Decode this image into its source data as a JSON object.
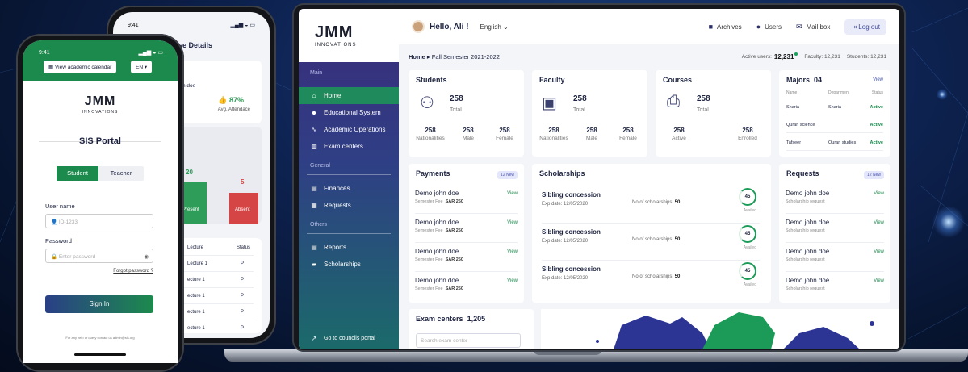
{
  "colors": {
    "accent": "#1f8a5b",
    "brand": "#2f3f85",
    "status_active": "#1c8a4d"
  },
  "laptop": {
    "logo": {
      "main": "JMM",
      "sub": "INNOVATIONS"
    },
    "sidebar": {
      "sections": [
        {
          "title": "Main",
          "items": [
            {
              "label": "Home",
              "icon": "home-icon",
              "active": true
            },
            {
              "label": "Educational System",
              "icon": "graduation-cap-icon"
            },
            {
              "label": "Academic Operations",
              "icon": "wave-icon"
            },
            {
              "label": "Exam centers",
              "icon": "building-icon"
            }
          ]
        },
        {
          "title": "General",
          "items": [
            {
              "label": "Finances",
              "icon": "document-icon"
            },
            {
              "label": "Requests",
              "icon": "file-icon"
            }
          ]
        },
        {
          "title": "Others",
          "items": [
            {
              "label": "Reports",
              "icon": "document-icon"
            },
            {
              "label": "Scholarships",
              "icon": "briefcase-icon"
            }
          ]
        }
      ],
      "footer": "Go to councils portal"
    },
    "header": {
      "greeting": "Hello, Ali !",
      "language": "English",
      "archives": "Archives",
      "users": "Users",
      "mailbox": "Mail box",
      "logout": "Log out"
    },
    "breadcrumb": {
      "home": "Home",
      "semester": "Fall Semester 2021-2022"
    },
    "active_users": {
      "label": "Active users:",
      "value": "12,231",
      "faculty": "Faculty: 12,231",
      "students": "Students: 12,231"
    },
    "students": {
      "title": "Students",
      "total": "258",
      "total_label": "Total",
      "stats": [
        {
          "v": "258",
          "l": "Nationalities"
        },
        {
          "v": "258",
          "l": "Male"
        },
        {
          "v": "258",
          "l": "Female"
        }
      ]
    },
    "faculty": {
      "title": "Faculty",
      "total": "258",
      "total_label": "Total",
      "stats": [
        {
          "v": "258",
          "l": "Nationalities"
        },
        {
          "v": "258",
          "l": "Male"
        },
        {
          "v": "258",
          "l": "Female"
        }
      ]
    },
    "courses": {
      "title": "Courses",
      "total": "258",
      "total_label": "Total",
      "stats": [
        {
          "v": "258",
          "l": "Active"
        },
        {
          "v": "258",
          "l": "Enrolled"
        }
      ]
    },
    "majors": {
      "title": "Majors",
      "count": "04",
      "view": "View",
      "headers": [
        "Name",
        "Department",
        "Status"
      ],
      "rows": [
        {
          "name": "Sharia",
          "dept": "Sharia",
          "status": "Active"
        },
        {
          "name": "Quran science",
          "dept": "",
          "status": "Active"
        },
        {
          "name": "Tafseer",
          "dept": "Quran studies",
          "status": "Active"
        }
      ]
    },
    "payments": {
      "title": "Payments",
      "badge": "12 New",
      "rows": [
        {
          "name": "Demo john doe",
          "sub": "Semester Fee",
          "amount": "SAR 250",
          "view": "View"
        },
        {
          "name": "Demo john doe",
          "sub": "Semester Fee",
          "amount": "SAR 250",
          "view": "View"
        },
        {
          "name": "Demo john doe",
          "sub": "Semester Fee",
          "amount": "SAR 250",
          "view": "View"
        },
        {
          "name": "Demo john doe",
          "sub": "Semester Fee",
          "amount": "SAR 250",
          "view": "View"
        }
      ]
    },
    "scholarships": {
      "title": "Scholarships",
      "rows": [
        {
          "name": "Sibling concession",
          "exp": "Exp date: 12/05/2020",
          "count_label": "No of scholarships:",
          "count": "50",
          "avail": "45",
          "avail_label": "Availed"
        },
        {
          "name": "Sibling concession",
          "exp": "Exp date: 12/05/2020",
          "count_label": "No of scholarships:",
          "count": "50",
          "avail": "45",
          "avail_label": "Availed"
        },
        {
          "name": "Sibling concession",
          "exp": "Exp date: 12/05/2020",
          "count_label": "No of scholarships:",
          "count": "50",
          "avail": "45",
          "avail_label": "Availed"
        }
      ]
    },
    "requests": {
      "title": "Requests",
      "badge": "12 New",
      "rows": [
        {
          "name": "Demo john doe",
          "sub": "Scholarship request",
          "view": "View"
        },
        {
          "name": "Demo john doe",
          "sub": "Scholarship request",
          "view": "View"
        },
        {
          "name": "Demo john doe",
          "sub": "Scholarship request",
          "view": "View"
        },
        {
          "name": "Demo john doe",
          "sub": "Scholarship request",
          "view": "View"
        }
      ]
    },
    "exam_centers": {
      "title": "Exam centers",
      "count": "1,205",
      "placeholder": "Search exam center"
    }
  },
  "phone1": {
    "time": "9:41",
    "calendar": "View academic calendar",
    "lang": "EN",
    "logo": {
      "main": "JMM",
      "sub": "INNOVATIONS"
    },
    "portal": "SIS Portal",
    "tabs": [
      "Student",
      "Teacher"
    ],
    "username_label": "User name",
    "username_placeholder": "ID-1233",
    "password_label": "Password",
    "password_placeholder": "Enter password",
    "forgot": "Forgot password ?",
    "signin": "Sign In",
    "help": "For any help or query contact us admin@sis.org"
  },
  "phone2": {
    "time": "9:41",
    "title": "urse Details",
    "name_frag": "n doe",
    "attendance": "87%",
    "attendance_label": "Avg. Attendace",
    "present_val": "20",
    "present": "Present",
    "absent_val": "5",
    "absent": "Absent",
    "col_lecture": "Lecture",
    "col_status": "Status",
    "rows": [
      {
        "l": "Lecture 1",
        "s": "P"
      },
      {
        "l": "ecture 1",
        "s": "P"
      },
      {
        "l": "ecture 1",
        "s": "P"
      },
      {
        "l": "ecture 1",
        "s": "P"
      },
      {
        "l": "ecture 1",
        "s": "P"
      }
    ]
  }
}
